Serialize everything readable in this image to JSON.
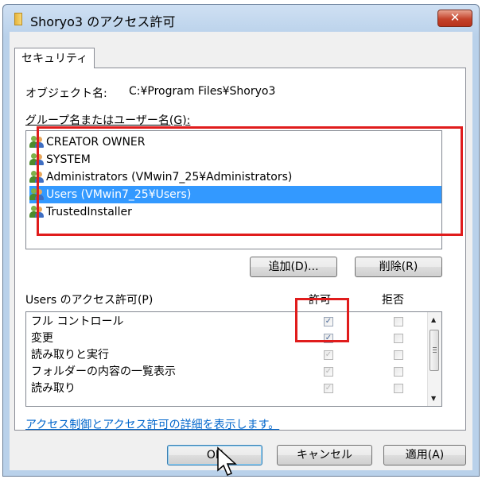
{
  "window": {
    "title": "Shoryo3 のアクセス許可",
    "close_glyph": "✕"
  },
  "tabs": [
    {
      "label": "セキュリティ"
    }
  ],
  "object": {
    "label": "オブジェクト名:",
    "value": "C:¥Program Files¥Shoryo3"
  },
  "groups": {
    "label": "グループ名またはユーザー名(G):",
    "items": [
      {
        "name": "CREATOR OWNER"
      },
      {
        "name": "SYSTEM"
      },
      {
        "name": "Administrators (VMwin7_25¥Administrators)"
      },
      {
        "name": "Users (VMwin7_25¥Users)",
        "selected": true
      },
      {
        "name": "TrustedInstaller"
      }
    ]
  },
  "buttons": {
    "add": "追加(D)...",
    "remove": "削除(R)",
    "ok": "OK",
    "cancel": "キャンセル",
    "apply": "適用(A)"
  },
  "permissions": {
    "label": "Users のアクセス許可(P)",
    "allow_header": "許可",
    "deny_header": "拒否",
    "rows": [
      {
        "name": "フル コントロール",
        "allow": true,
        "deny": false
      },
      {
        "name": "変更",
        "allow": true,
        "deny": false
      },
      {
        "name": "読み取りと実行",
        "allow": true,
        "deny": false
      },
      {
        "name": "フォルダーの内容の一覧表示",
        "allow": true,
        "deny": false
      },
      {
        "name": "読み取り",
        "allow": true,
        "deny": false
      }
    ]
  },
  "help_link": "アクセス制御とアクセス許可の詳細を表示します。",
  "colors": {
    "selection": "#3399ff",
    "highlight_box": "#e01c1c",
    "link": "#0066cc"
  }
}
